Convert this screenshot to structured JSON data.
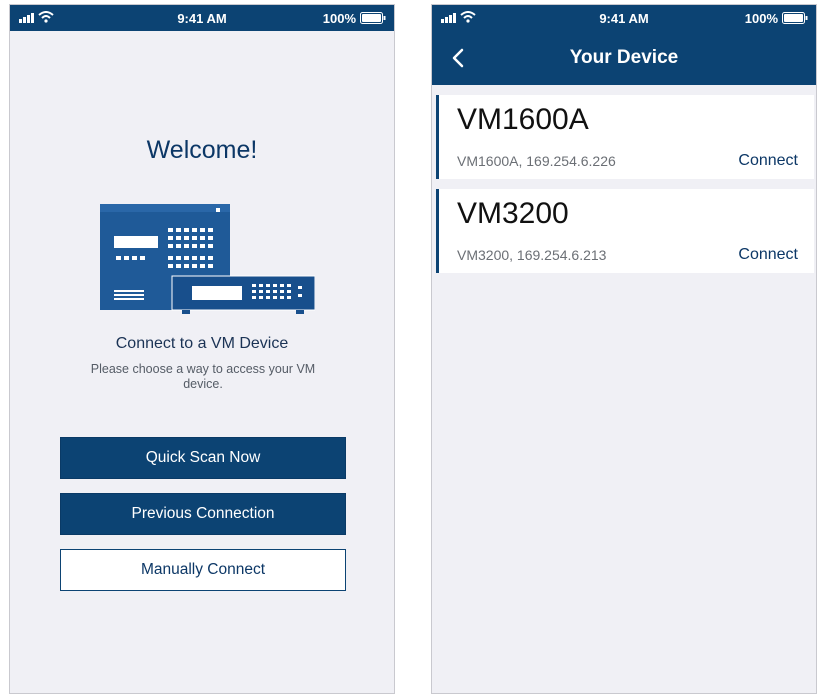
{
  "status_bar": {
    "time": "9:41 AM",
    "battery": "100%"
  },
  "welcome_screen": {
    "heading": "Welcome!",
    "connect_title": "Connect to a VM Device",
    "connect_description": "Please choose a way to access your VM device.",
    "buttons": {
      "quick_scan": "Quick Scan Now",
      "previous": "Previous Connection",
      "manual": "Manually Connect"
    }
  },
  "device_screen": {
    "title": "Your Device",
    "devices": [
      {
        "name": "VM1600A",
        "info": "VM1600A, 169.254.6.226",
        "action": "Connect"
      },
      {
        "name": "VM3200",
        "info": "VM3200, 169.254.6.213",
        "action": "Connect"
      }
    ]
  },
  "colors": {
    "primary": "#0c4373",
    "background": "#f0f0f5",
    "text_dark": "#0c3766"
  },
  "icons": [
    "signal-icon",
    "wifi-icon",
    "battery-icon",
    "back-chevron-icon",
    "vm-device-illustration"
  ]
}
